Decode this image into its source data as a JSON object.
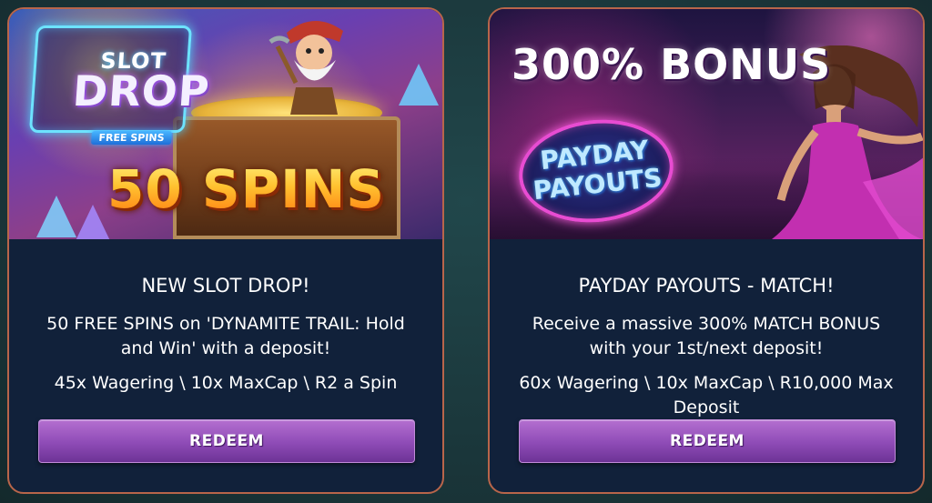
{
  "colors": {
    "card_border": "#b8654a",
    "card_bg": "#11213a",
    "button_top": "#b46fd0",
    "button_bottom": "#6d3396",
    "page_bg": "#1c3b3f"
  },
  "promotions": [
    {
      "banner": {
        "logo_line1": "SLOT",
        "logo_line2": "DROP",
        "logo_tag": "FREE SPINS",
        "headline": "50 SPINS"
      },
      "title": "NEW SLOT DROP!",
      "description": "50 FREE SPINS on 'DYNAMITE TRAIL: Hold and Win' with a deposit!",
      "terms": "45x Wagering \\ 10x MaxCap \\ R2 a Spin",
      "button_label": "REDEEM"
    },
    {
      "banner": {
        "headline": "300% BONUS",
        "badge_line1": "PAYDAY",
        "badge_line2": "PAYOUTS"
      },
      "title": "PAYDAY PAYOUTS - MATCH!",
      "description": "Receive a massive 300% MATCH BONUS with your 1st/next deposit!",
      "terms": "60x Wagering \\ 10x MaxCap \\ R10,000 Max Deposit",
      "button_label": "REDEEM"
    }
  ]
}
